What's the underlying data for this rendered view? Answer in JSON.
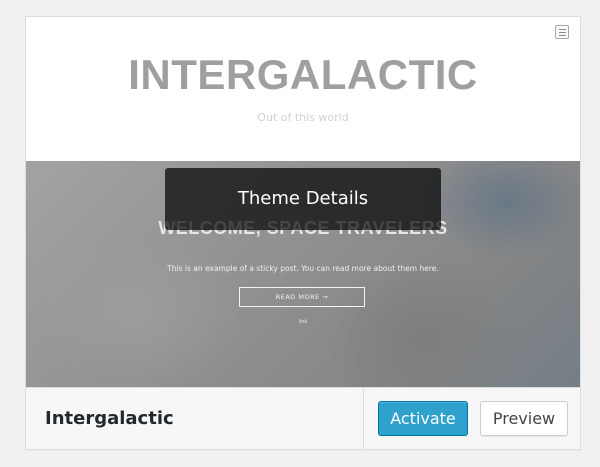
{
  "screenshot": {
    "site_title": "INTERGALACTIC",
    "tagline": "Out of this world",
    "hero_heading": "WELCOME, SPACE TRAVELERS",
    "hero_text": "This is an example of a sticky post. You can read more about them here.",
    "read_more": "READ MORE →",
    "hero_meta": "link",
    "menu_icon": "hamburger-menu-icon"
  },
  "overlay": {
    "label": "Theme Details"
  },
  "footer": {
    "theme_name": "Intergalactic",
    "activate_label": "Activate",
    "preview_label": "Preview"
  },
  "colors": {
    "activate_bg": "#2ea2cc",
    "activate_border": "#0074a2",
    "overlay_bg": "rgba(0,0,0,0.7)"
  }
}
